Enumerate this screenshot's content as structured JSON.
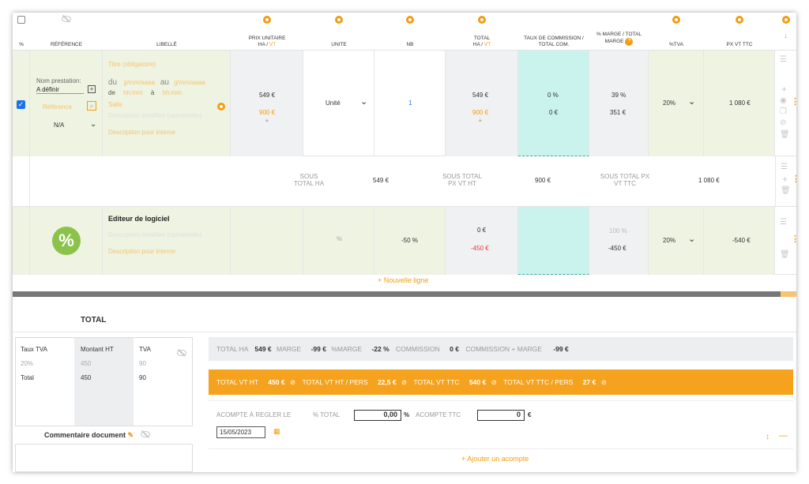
{
  "header": {
    "pct": "%",
    "ref": "RÉFÉRENCE",
    "libelle": "LIBELLÉ",
    "prix_ha": "PRIX UNITAIRE",
    "prix_ha2_a": "HA / ",
    "prix_ha2_b": "VT",
    "unite": "UNITE",
    "nb": "NB",
    "total_a": "TOTAL",
    "total_b": "HA / ",
    "total_c": "VT",
    "taux_comm": "TAUX DE COMMISSION /",
    "taux_comm2": "TOTAL COM.",
    "marge": "% MARGE / TOTAL",
    "marge2": "MARGE",
    "tva": "%TVA",
    "pxvt": "PX VT TTC",
    "arrow": "↓"
  },
  "row1": {
    "nom_prestation_label": "Nom prestation:",
    "nom_prestation_value": "A définir",
    "reference_placeholder": "Référence",
    "na": "N/A",
    "titre": "Titre (obligatoire)",
    "du": "du",
    "date1": "jj/mm/aaaa",
    "au": "au",
    "date2": "jj/mm/aaaa",
    "de": "de",
    "time1": "hh:mm",
    "a": "à",
    "time2": "hh:mm",
    "salle": "Salle",
    "desc": "Description détaillée (optionnelle)",
    "desc_int": "Description pour interne",
    "prix_ha": "549 €",
    "prix_vt": "900 €",
    "unite": "Unité",
    "nb": "1",
    "total_ha": "549 €",
    "total_vt": "900 €",
    "comm_pct": "0 %",
    "comm_val": "0 €",
    "marge_pct": "39 %",
    "marge_val": "351 €",
    "tva": "20%",
    "pxvt": "1 080 €"
  },
  "subtotal": {
    "sous_total_ha_a": "SOUS",
    "sous_total_ha_b": "TOTAL HA",
    "sous_total_ha_val": "549 €",
    "sous_total_vt_a": "SOUS TOTAL",
    "sous_total_vt_b": "PX VT HT",
    "sous_total_vt_val": "900 €",
    "sous_total_ttc_a": "SOUS TOTAL PX",
    "sous_total_ttc_b": "VT TTC",
    "sous_total_ttc_val": "1 080 €"
  },
  "row2": {
    "title": "Editeur de logiciel",
    "desc": "Description détaillée (optionnelle)",
    "desc_int": "Description pour interne",
    "unite": "%",
    "nb": "-50 %",
    "total_ha": "0 €",
    "total_vt": "-450 €",
    "marge_pct": "100 %",
    "marge_val": "-450 €",
    "tva": "20%",
    "pxvt": "-540 €"
  },
  "nouvelle_ligne": "+ Nouvelle ligne",
  "total": {
    "title": "TOTAL",
    "tva_headers": [
      "Taux TVA",
      "Montant HT",
      "TVA"
    ],
    "tva_rows": [
      [
        "20%",
        "450",
        "90"
      ],
      [
        "Total",
        "450",
        "90"
      ]
    ],
    "commentaire": "Commentaire document",
    "bar1": [
      {
        "label": "TOTAL HA",
        "value": "549 €"
      },
      {
        "label": "MARGE",
        "value": "-99 €"
      },
      {
        "label": "%MARGE",
        "value": "-22 %"
      },
      {
        "label": "COMMISSION",
        "value": "0 €"
      },
      {
        "label": "COMMISSION + MARGE",
        "value": "-99 €"
      }
    ],
    "bar2": [
      {
        "label": "TOTAL VT HT",
        "value": "450 €"
      },
      {
        "label": "TOTAL VT HT / PERS",
        "value": "22,5 €"
      },
      {
        "label": "TOTAL VT TTC",
        "value": "540 €"
      },
      {
        "label": "TOTAL VT TTC / PERS",
        "value": "27 €"
      }
    ],
    "acompte_label": "ACOMPTE À REGLER LE",
    "pct_total_label": "% TOTAL",
    "pct_total_value": "0,00",
    "pct_sign": "%",
    "acompte_ttc_label": "ACOMPTE TTC",
    "acompte_ttc_value": "0",
    "euro": "€",
    "date": "15/05/2023",
    "ajouter": "+ Ajouter un acompte"
  }
}
